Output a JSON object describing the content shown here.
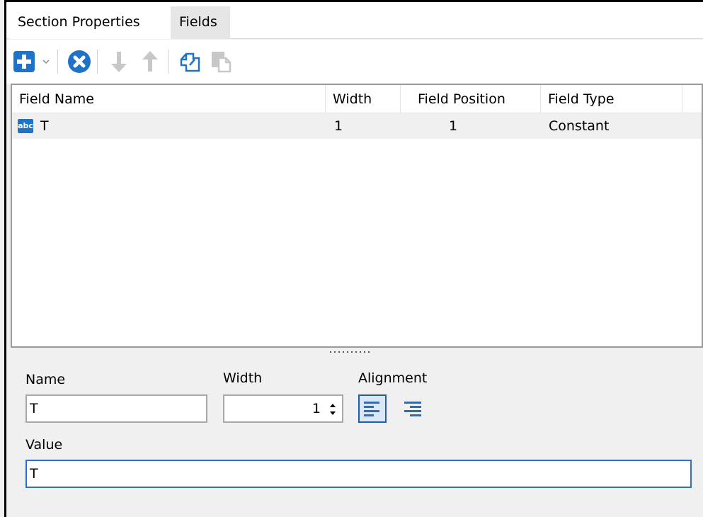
{
  "tabs": [
    {
      "label": "Section Properties",
      "active": false
    },
    {
      "label": "Fields",
      "active": true
    }
  ],
  "toolbar": {
    "items": [
      "add-icon",
      "dropdown-caret",
      "delete-icon",
      "move-down-icon",
      "move-up-icon",
      "copy-icon",
      "paste-icon"
    ],
    "accent": "#1e73c9",
    "disabled_color": "#c7c7c7"
  },
  "grid": {
    "columns": [
      "Field Name",
      "Width",
      "Field Position",
      "Field Type"
    ],
    "rows": [
      {
        "icon": "abc",
        "name": "T",
        "width": "1",
        "position": "1",
        "type": "Constant"
      }
    ]
  },
  "editor": {
    "name_label": "Name",
    "name_value": "T",
    "width_label": "Width",
    "width_value": "1",
    "alignment_label": "Alignment",
    "alignment_options": [
      "align-left-icon",
      "align-right-icon"
    ],
    "value_label": "Value",
    "value_value": "T"
  }
}
